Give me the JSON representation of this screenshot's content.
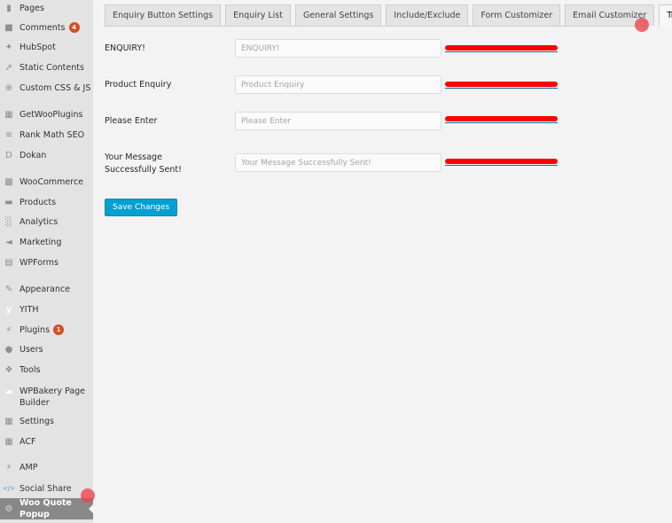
{
  "sidebar": {
    "items": [
      {
        "label": "Pages",
        "icon": "pages-icon"
      },
      {
        "label": "Comments",
        "icon": "comments-icon",
        "badge": "4"
      },
      {
        "label": "HubSpot",
        "icon": "hubspot-icon"
      },
      {
        "label": "Static Contents",
        "icon": "pin-icon"
      },
      {
        "label": "Custom CSS & JS",
        "icon": "plus-circle-icon"
      },
      {
        "label": "GetWooPlugins",
        "icon": "getwooplugins-icon"
      },
      {
        "label": "Rank Math SEO",
        "icon": "rank-math-icon"
      },
      {
        "label": "Dokan",
        "icon": "dokan-icon"
      },
      {
        "label": "WooCommerce",
        "icon": "woocommerce-icon"
      },
      {
        "label": "Products",
        "icon": "products-icon"
      },
      {
        "label": "Analytics",
        "icon": "analytics-icon"
      },
      {
        "label": "Marketing",
        "icon": "megaphone-icon"
      },
      {
        "label": "WPForms",
        "icon": "wpforms-icon"
      },
      {
        "label": "Appearance",
        "icon": "paintbrush-icon"
      },
      {
        "label": "YITH",
        "icon": "yith-icon"
      },
      {
        "label": "Plugins",
        "icon": "plugins-icon",
        "badge": "1"
      },
      {
        "label": "Users",
        "icon": "users-icon"
      },
      {
        "label": "Tools",
        "icon": "wrench-icon"
      },
      {
        "label": "WPBakery Page Builder",
        "icon": "cloud-icon"
      },
      {
        "label": "Settings",
        "icon": "settings-icon"
      },
      {
        "label": "ACF",
        "icon": "acf-icon"
      },
      {
        "label": "AMP",
        "icon": "amp-icon"
      },
      {
        "label": "Social Share",
        "icon": "code-icon"
      },
      {
        "label": "Woo Quote Popup",
        "icon": "gear-icon",
        "active": true
      }
    ]
  },
  "tabs": [
    {
      "label": "Enquiry Button Settings"
    },
    {
      "label": "Enquiry List"
    },
    {
      "label": "General Settings"
    },
    {
      "label": "Include/Exclude"
    },
    {
      "label": "Form Customizer"
    },
    {
      "label": "Email Customizer"
    },
    {
      "label": "Translate",
      "active": true
    }
  ],
  "fields": [
    {
      "label": "ENQUIRY!",
      "value": "",
      "placeholder": "ENQUIRY!",
      "link": "[redacted]"
    },
    {
      "label": "Product Enquiry",
      "value": "",
      "placeholder": "Product Enquiry",
      "link": "[redacted]"
    },
    {
      "label": "Please Enter",
      "value": "",
      "placeholder": "Please Enter",
      "link": "[redacted]"
    },
    {
      "label": "Your Message Successfully Sent!",
      "value": "",
      "placeholder": "Your Message Successfully Sent!",
      "link": "[redacted]"
    }
  ],
  "save_button": {
    "label": "Save Changes"
  },
  "colors": {
    "accent": "#00a0d2",
    "link": "#0073aa",
    "badge": "#d54e21",
    "redaction": "#ff0000",
    "active_menu": "#888888"
  }
}
